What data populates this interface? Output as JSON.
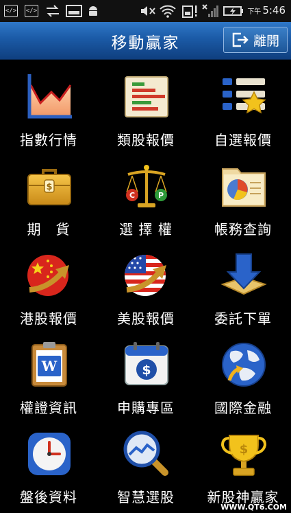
{
  "status_bar": {
    "time_prefix": "下午",
    "time": "5:46"
  },
  "header": {
    "title": "移動贏家",
    "exit_label": "離開"
  },
  "menu": [
    {
      "label": "指數行情",
      "icon": "index-chart-icon"
    },
    {
      "label": "類股報價",
      "icon": "sector-bars-icon"
    },
    {
      "label": "自選報價",
      "icon": "watchlist-star-icon"
    },
    {
      "label": "期　貨",
      "icon": "briefcase-dollar-icon"
    },
    {
      "label": "選 擇 權",
      "icon": "scale-cp-icon"
    },
    {
      "label": "帳務查詢",
      "icon": "folder-pie-icon"
    },
    {
      "label": "港股報價",
      "icon": "china-flag-icon"
    },
    {
      "label": "美股報價",
      "icon": "us-flag-icon"
    },
    {
      "label": "委託下單",
      "icon": "down-arrow-icon"
    },
    {
      "label": "權證資訊",
      "icon": "clipboard-w-icon"
    },
    {
      "label": "申購專區",
      "icon": "calendar-dollar-icon"
    },
    {
      "label": "國際金融",
      "icon": "globe-icon"
    },
    {
      "label": "盤後資料",
      "icon": "clock-icon"
    },
    {
      "label": "智慧選股",
      "icon": "magnifier-chart-icon"
    },
    {
      "label": "新股神贏家",
      "icon": "trophy-icon"
    }
  ],
  "watermark": "WWW.QT6.COM"
}
